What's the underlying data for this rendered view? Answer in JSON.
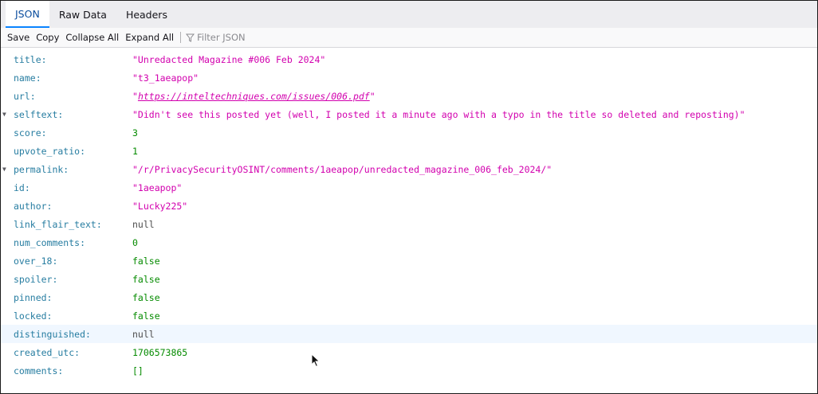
{
  "tabs": [
    {
      "label": "JSON",
      "active": true
    },
    {
      "label": "Raw Data",
      "active": false
    },
    {
      "label": "Headers",
      "active": false
    }
  ],
  "toolbar": {
    "save": "Save",
    "copy": "Copy",
    "collapse_all": "Collapse All",
    "expand_all": "Expand All",
    "filter_placeholder": "Filter JSON"
  },
  "rows": [
    {
      "key": "title:",
      "value": "\"Unredacted Magazine #006 Feb 2024\"",
      "type": "string"
    },
    {
      "key": "name:",
      "value": "\"t3_1aeapop\"",
      "type": "string"
    },
    {
      "key": "url:",
      "quote_open": "\"",
      "link": "https://inteltechniques.com/issues/006.pdf",
      "quote_close": "\"",
      "type": "link"
    },
    {
      "key": "selftext:",
      "value": "\"Didn't see this posted yet (well, I posted it a minute ago with a typo in the title so deleted and reposting)\"",
      "type": "string",
      "expandable": true
    },
    {
      "key": "score:",
      "value": "3",
      "type": "number"
    },
    {
      "key": "upvote_ratio:",
      "value": "1",
      "type": "number"
    },
    {
      "key": "permalink:",
      "value": "\"/r/PrivacySecurityOSINT/comments/1aeapop/unredacted_magazine_006_feb_2024/\"",
      "type": "string",
      "expandable": true
    },
    {
      "key": "id:",
      "value": "\"1aeapop\"",
      "type": "string"
    },
    {
      "key": "author:",
      "value": "\"Lucky225\"",
      "type": "string"
    },
    {
      "key": "link_flair_text:",
      "value": "null",
      "type": "null"
    },
    {
      "key": "num_comments:",
      "value": "0",
      "type": "number"
    },
    {
      "key": "over_18:",
      "value": "false",
      "type": "boolean"
    },
    {
      "key": "spoiler:",
      "value": "false",
      "type": "boolean"
    },
    {
      "key": "pinned:",
      "value": "false",
      "type": "boolean"
    },
    {
      "key": "locked:",
      "value": "false",
      "type": "boolean"
    },
    {
      "key": "distinguished:",
      "value": "null",
      "type": "null",
      "highlighted": true
    },
    {
      "key": "created_utc:",
      "value": "1706573865",
      "type": "number"
    },
    {
      "key": "comments:",
      "value": "[]",
      "type": "array"
    }
  ],
  "colors": {
    "key": "#277da1",
    "string": "#d200ae",
    "number": "#058b00",
    "null": "#4d4d4d",
    "accent": "#0a84ff"
  },
  "icons": {
    "expand": "triangle-down-icon",
    "filter": "funnel-icon",
    "pointer": "mouse-pointer-icon"
  }
}
